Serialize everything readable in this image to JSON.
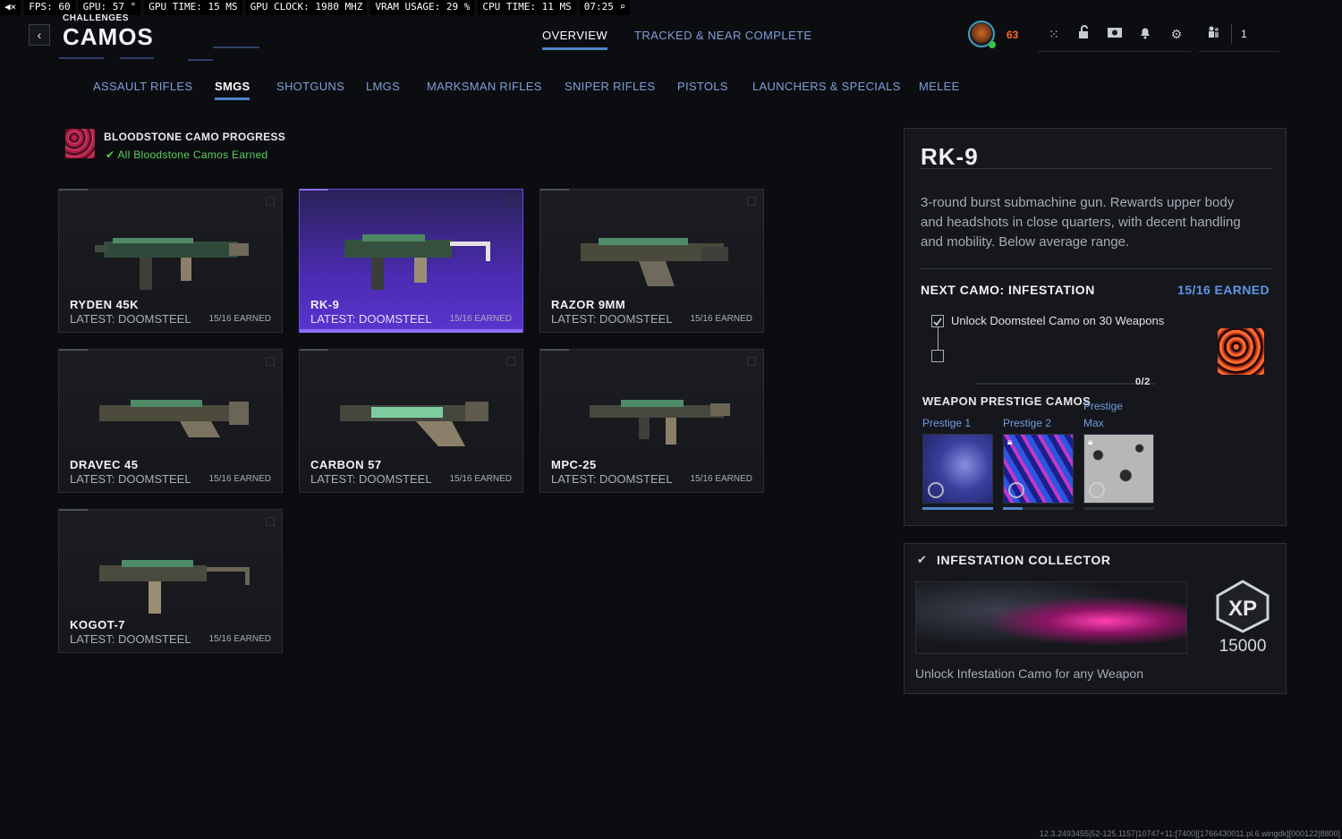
{
  "overlay": {
    "fps": "FPS:  60",
    "gpu": "GPU: 57 °",
    "gpu_time": "GPU TIME: 15 MS",
    "gpu_clock": "GPU CLOCK: 1980 MHZ",
    "vram": "VRAM USAGE: 29 %",
    "cpu_time": "CPU TIME: 11 MS",
    "clock": "07:25 ⌕"
  },
  "header": {
    "back_glyph": "‹",
    "section": "CHALLENGES",
    "title": "CAMOS",
    "tabs": [
      {
        "label": "OVERVIEW",
        "active": true
      },
      {
        "label": "TRACKED & NEAR COMPLETE",
        "active": false
      }
    ],
    "player_level": "63",
    "party_count": "1",
    "icons": [
      "grid-icon",
      "unlock-icon",
      "camera-icon",
      "bell-icon",
      "gear-icon",
      "party-icon"
    ]
  },
  "categories": [
    {
      "label": "ASSAULT RIFLES",
      "active": false
    },
    {
      "label": "SMGS",
      "active": true
    },
    {
      "label": "SHOTGUNS",
      "active": false
    },
    {
      "label": "LMGS",
      "active": false
    },
    {
      "label": "MARKSMAN RIFLES",
      "active": false
    },
    {
      "label": "SNIPER RIFLES",
      "active": false
    },
    {
      "label": "PISTOLS",
      "active": false
    },
    {
      "label": "LAUNCHERS & SPECIALS",
      "active": false
    },
    {
      "label": "MELEE",
      "active": false
    }
  ],
  "bloodstone": {
    "title": "BLOODSTONE CAMO PROGRESS",
    "status": "✔ All Bloodstone Camos Earned"
  },
  "weapons": [
    {
      "name": "RYDEN 45K",
      "latest": "LATEST: DOOMSTEEL",
      "earned": "15/16 EARNED",
      "selected": false
    },
    {
      "name": "RK-9",
      "latest": "LATEST: DOOMSTEEL",
      "earned": "15/16 EARNED",
      "selected": true
    },
    {
      "name": "RAZOR 9MM",
      "latest": "LATEST: DOOMSTEEL",
      "earned": "15/16 EARNED",
      "selected": false
    },
    {
      "name": "DRAVEC 45",
      "latest": "LATEST: DOOMSTEEL",
      "earned": "15/16 EARNED",
      "selected": false
    },
    {
      "name": "CARBON 57",
      "latest": "LATEST: DOOMSTEEL",
      "earned": "15/16 EARNED",
      "selected": false
    },
    {
      "name": "MPC-25",
      "latest": "LATEST: DOOMSTEEL",
      "earned": "15/16 EARNED",
      "selected": false
    },
    {
      "name": "KOGOT-7",
      "latest": "LATEST: DOOMSTEEL",
      "earned": "15/16 EARNED",
      "selected": false
    }
  ],
  "detail": {
    "title": "RK-9",
    "description": "3-round burst submachine gun. Rewards upper body and headshots in close quarters, with decent handling and mobility. Below average range.",
    "next_camo_label": "NEXT CAMO: INFESTATION",
    "next_camo_earned": "15/16 EARNED",
    "task": "Unlock Doomsteel Camo on 30 Weapons",
    "task_progress": "0/2",
    "task_progress_fraction": 0.0,
    "prestige_label": "WEAPON PRESTIGE CAMOS",
    "prestige_tag": "Prestige",
    "prestige": [
      {
        "label": "Prestige 1",
        "locked": false,
        "progress": 1.0
      },
      {
        "label": "Prestige 2",
        "locked": true,
        "progress": 0.28
      },
      {
        "label": "Max",
        "locked": true,
        "progress": 0.0
      }
    ]
  },
  "collector": {
    "title": "INFESTATION COLLECTOR",
    "xp_label": "XP",
    "xp_value": "15000",
    "description": "Unlock Infestation Camo for any Weapon"
  },
  "build_version": "12.3.2493455|52-125.1157|10747+11:[7400][1766430011.pl.6.wingdk][000122|8800]"
}
